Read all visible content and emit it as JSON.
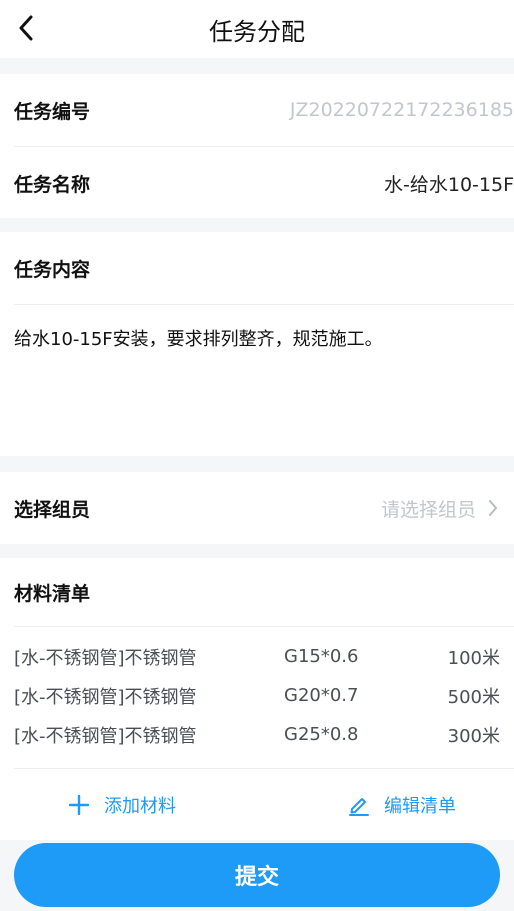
{
  "header": {
    "back_icon": "back-chevron-icon",
    "title": "任务分配"
  },
  "task": {
    "id_label": "任务编号",
    "id_value": "JZ20220722172236185",
    "name_label": "任务名称",
    "name_value": "水-给水10-15F",
    "content_label": "任务内容",
    "content_value": "给水10-15F安装，要求排列整齐，规范施工。"
  },
  "members": {
    "label": "选择组员",
    "placeholder": "请选择组员",
    "chevron_icon": "chevron-right-icon"
  },
  "materials": {
    "label": "材料清单",
    "items": [
      {
        "name": "[水-不锈钢管]不锈钢管",
        "spec": "G15*0.6",
        "qty": "100米"
      },
      {
        "name": "[水-不锈钢管]不锈钢管",
        "spec": "G20*0.7",
        "qty": "500米"
      },
      {
        "name": "[水-不锈钢管]不锈钢管",
        "spec": "G25*0.8",
        "qty": "300米"
      }
    ],
    "add_label": "添加材料",
    "add_icon": "plus-icon",
    "edit_label": "编辑清单",
    "edit_icon": "pencil-icon"
  },
  "submit_label": "提交",
  "colors": {
    "accent": "#1e9bf6",
    "background": "#f5f6f8",
    "muted_text": "#c3c6cc"
  }
}
